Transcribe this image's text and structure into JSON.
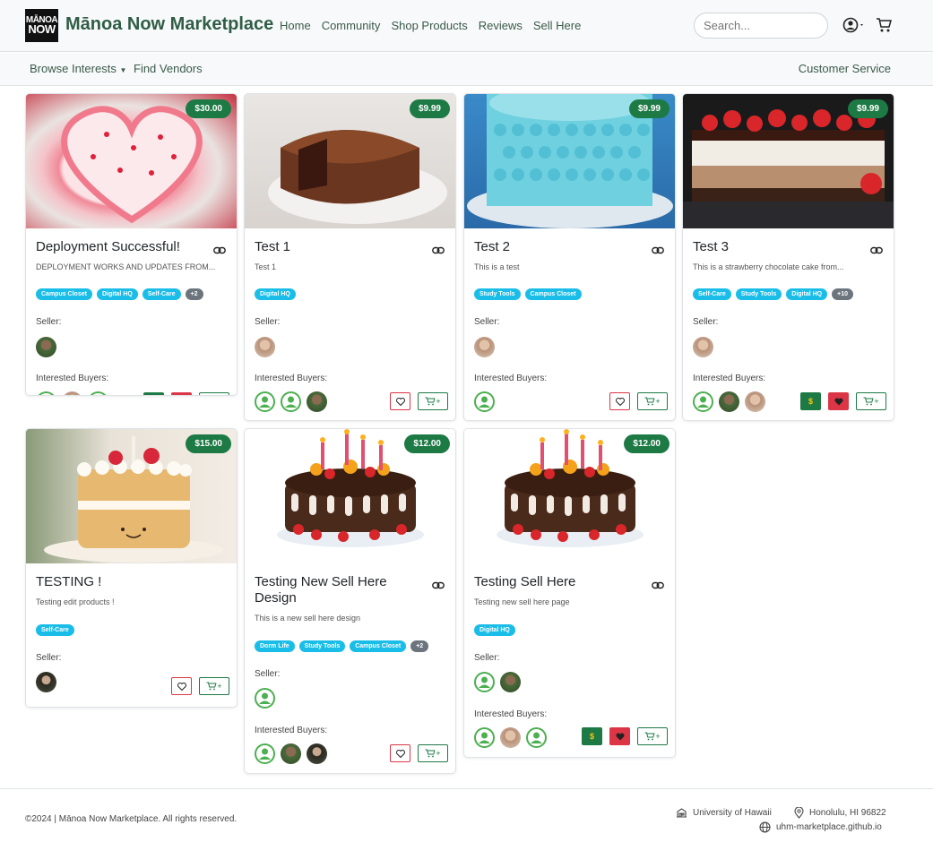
{
  "brand": {
    "logo_line1": "MĀNOA",
    "logo_line2": "NOW",
    "name": "Mānoa Now Marketplace"
  },
  "nav": {
    "items": [
      "Home",
      "Community",
      "Shop Products",
      "Reviews",
      "Sell Here"
    ]
  },
  "search": {
    "placeholder": "Search..."
  },
  "subnav": {
    "browse": "Browse Interests",
    "vendors": "Find Vendors",
    "service": "Customer Service"
  },
  "labels": {
    "seller": "Seller:",
    "buyers": "Interested Buyers:",
    "dollar": "$",
    "cart_plus": "+"
  },
  "cards": [
    {
      "price": "$30.00",
      "title": "Deployment Successful!",
      "desc": "DEPLOYMENT WORKS AND UPDATES FROM...",
      "tags": [
        "Campus Closet",
        "Digital HQ",
        "Self-Care",
        "+2"
      ]
    },
    {
      "price": "$9.99",
      "title": "Test 1",
      "desc": "Test 1",
      "tags": [
        "Digital HQ"
      ]
    },
    {
      "price": "$9.99",
      "title": "Test 2",
      "desc": "This is a test",
      "tags": [
        "Study Tools",
        "Campus Closet"
      ]
    },
    {
      "price": "$9.99",
      "title": "Test 3",
      "desc": "This is a strawberry chocolate cake from...",
      "tags": [
        "Self-Care",
        "Study Tools",
        "Digital HQ",
        "+10"
      ]
    },
    {
      "price": "$15.00",
      "title": "TESTING !",
      "desc": "Testing edit products !",
      "tags": [
        "Self-Care"
      ]
    },
    {
      "price": "$12.00",
      "title": "Testing New Sell Here Design",
      "desc": "This is a new sell here design",
      "tags": [
        "Dorm Life",
        "Study Tools",
        "Campus Closet",
        "+2"
      ]
    },
    {
      "price": "$12.00",
      "title": "Testing Sell Here",
      "desc": "Testing new sell here page",
      "tags": [
        "Digital HQ"
      ]
    }
  ],
  "footer": {
    "copyright": "©2024 | Mānoa Now Marketplace.  All rights reserved.",
    "university": "University of Hawaii",
    "location": "Honolulu, HI 96822",
    "site": "uhm-marketplace.github.io"
  },
  "colors": {
    "accent": "#1d7a45",
    "brand_text": "#2f5d46",
    "tag": "#19bde8",
    "heart": "#dc3545"
  },
  "icons": [
    "user-circle-icon",
    "cart-icon",
    "link-icon",
    "heart-icon",
    "dollar-icon",
    "building-icon",
    "map-pin-icon",
    "globe-icon"
  ]
}
